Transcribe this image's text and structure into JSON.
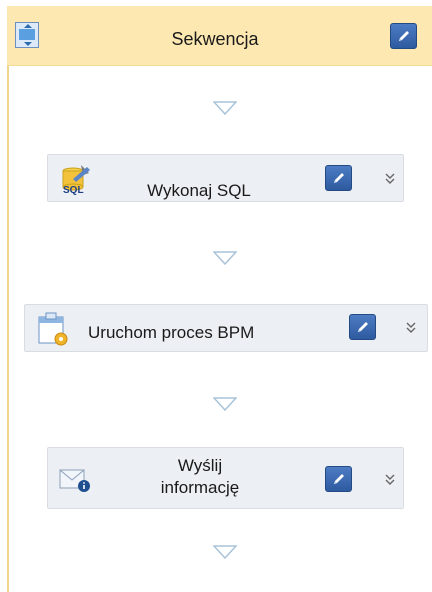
{
  "sequence": {
    "title": "Sekwencja",
    "icon": "sequence-icon"
  },
  "steps": [
    {
      "label": "Wykonaj SQL",
      "icon": "sql-icon",
      "icon_text": "SQL"
    },
    {
      "label": "Uruchom proces BPM",
      "icon": "bpm-process-icon"
    },
    {
      "label_line1": "Wyślij",
      "label_line2": "informację",
      "icon": "mail-info-icon"
    }
  ],
  "colors": {
    "header_bg": "#fce8b0",
    "border": "#f0d58a",
    "step_bg": "#eceff3",
    "edit_button": "#3a6ab4",
    "arrow": "#a9c3d9"
  }
}
